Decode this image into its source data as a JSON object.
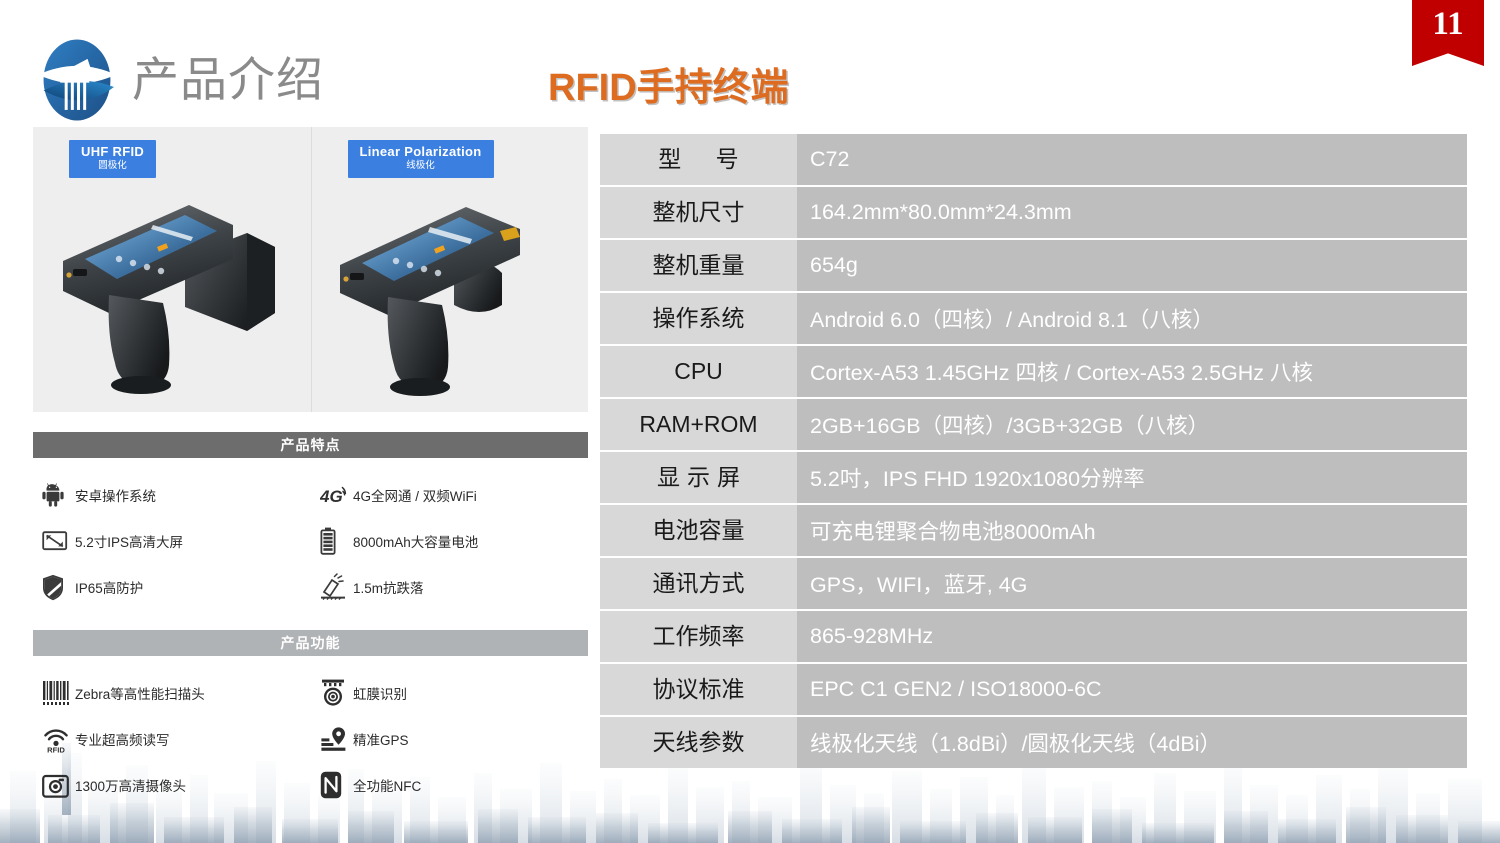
{
  "header": {
    "section_title": "产品介绍",
    "main_title": "RFID手持终端",
    "page_number": "11",
    "logo_name": "company-pillar-logo"
  },
  "gallery": {
    "items": [
      {
        "tag_en": "UHF RFID",
        "tag_cn": "圆极化",
        "device_alt": "rfid-handheld-circular-polarization"
      },
      {
        "tag_en": "Linear Polarization",
        "tag_cn": "线极化",
        "device_alt": "rfid-handheld-linear-polarization"
      }
    ]
  },
  "features_section": {
    "heading": "产品特点",
    "items": [
      {
        "icon": "android-robot-icon",
        "label": "安卓操作系统"
      },
      {
        "icon": "4g-signal-icon",
        "label": "4G全网通 / 双频WiFi"
      },
      {
        "icon": "screen-diagonal-icon",
        "label": "5.2寸IPS高清大屏"
      },
      {
        "icon": "battery-icon",
        "label": "8000mAh大容量电池"
      },
      {
        "icon": "shield-icon",
        "label": "IP65高防护"
      },
      {
        "icon": "drop-test-icon",
        "label": "1.5m抗跌落"
      }
    ]
  },
  "functions_section": {
    "heading": "产品功能",
    "items": [
      {
        "icon": "barcode-icon",
        "label": "Zebra等高性能扫描头"
      },
      {
        "icon": "iris-scan-icon",
        "label": "虹膜识别"
      },
      {
        "icon": "rfid-wave-icon",
        "label": "专业超高频读写"
      },
      {
        "icon": "gps-pin-icon",
        "label": "精准GPS"
      },
      {
        "icon": "camera-icon",
        "label": "1300万高清摄像头"
      },
      {
        "icon": "nfc-icon",
        "label": "全功能NFC"
      }
    ]
  },
  "spec_table": {
    "rows": [
      {
        "key": "型 号",
        "spaced": "wide",
        "value": "C72"
      },
      {
        "key": "整机尺寸",
        "spaced": "none",
        "value": "164.2mm*80.0mm*24.3mm"
      },
      {
        "key": "整机重量",
        "spaced": "none",
        "value": "654g"
      },
      {
        "key": "操作系统",
        "spaced": "none",
        "value": "Android 6.0（四核）/ Android 8.1（八核）"
      },
      {
        "key": "CPU",
        "spaced": "none",
        "value": "Cortex-A53 1.45GHz 四核 / Cortex-A53 2.5GHz 八核"
      },
      {
        "key": "RAM+ROM",
        "spaced": "none",
        "value": "2GB+16GB（四核）/3GB+32GB（八核）"
      },
      {
        "key": "显示屏",
        "spaced": "narrow",
        "value": "5.2吋，IPS FHD 1920x1080分辨率"
      },
      {
        "key": "电池容量",
        "spaced": "none",
        "value": "可充电锂聚合物电池8000mAh"
      },
      {
        "key": "通讯方式",
        "spaced": "none",
        "value": "GPS，WIFI，蓝牙, 4G"
      },
      {
        "key": "工作频率",
        "spaced": "none",
        "value": "865-928MHz"
      },
      {
        "key": "协议标准",
        "spaced": "none",
        "value": "EPC C1 GEN2 / ISO18000-6C"
      },
      {
        "key": "天线参数",
        "spaced": "none",
        "value": "线极化天线（1.8dBi）/圆极化天线（4dBi）"
      }
    ]
  },
  "colors": {
    "accent_orange": "#dd6b20",
    "ribbon_red": "#c00000",
    "tag_blue": "#3b7fe0",
    "bar_dark": "#6d6d6d",
    "bar_light": "#b0b3b5",
    "spec_key_bg": "#d8d8d8",
    "spec_value_bg": "#bebebe",
    "section_title_gray": "#8a8a8a"
  }
}
